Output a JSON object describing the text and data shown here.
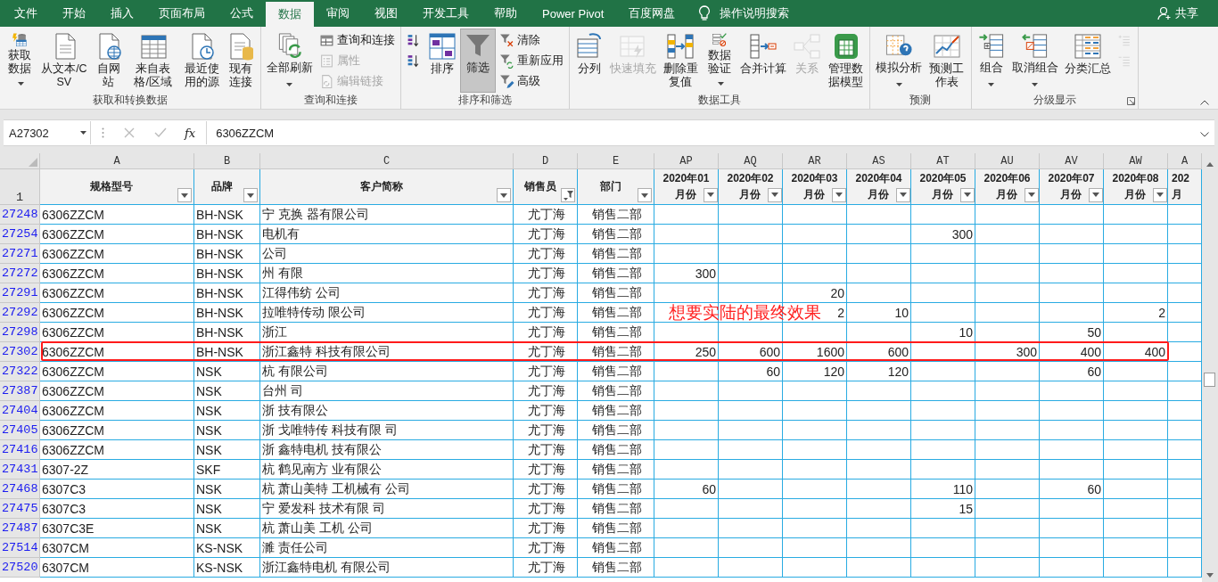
{
  "title_bar": {
    "tabs": [
      {
        "label": "文件",
        "selected": false
      },
      {
        "label": "开始",
        "selected": false
      },
      {
        "label": "插入",
        "selected": false
      },
      {
        "label": "页面布局",
        "selected": false
      },
      {
        "label": "公式",
        "selected": false
      },
      {
        "label": "数据",
        "selected": true
      },
      {
        "label": "审阅",
        "selected": false
      },
      {
        "label": "视图",
        "selected": false
      },
      {
        "label": "开发工具",
        "selected": false
      },
      {
        "label": "帮助",
        "selected": false
      },
      {
        "label": "Power Pivot",
        "selected": false
      },
      {
        "label": "百度网盘",
        "selected": false
      }
    ],
    "search": "操作说明搜索",
    "share": "共享"
  },
  "ribbon": {
    "groups": [
      {
        "label": "获取和转换数据",
        "launcher": false,
        "buttons": [
          {
            "kind": "tall",
            "label": "获取数据",
            "dropdown": true,
            "disabled": false,
            "pressed": false
          },
          {
            "kind": "tall",
            "label": "从文本/CSV",
            "dropdown": false,
            "disabled": false,
            "pressed": false
          },
          {
            "kind": "tall",
            "label": "自网站",
            "dropdown": false,
            "disabled": false,
            "pressed": false
          },
          {
            "kind": "tall",
            "label": "来自表格/区域",
            "dropdown": false,
            "disabled": false,
            "pressed": false
          },
          {
            "kind": "tall",
            "label": "最近使用的源",
            "dropdown": false,
            "disabled": false,
            "pressed": false
          },
          {
            "kind": "tall",
            "label": "现有连接",
            "dropdown": false,
            "disabled": false,
            "pressed": false
          }
        ]
      },
      {
        "label": "查询和连接",
        "launcher": false,
        "buttons": [
          {
            "kind": "large",
            "label": "全部刷新",
            "dropdown": true,
            "disabled": false,
            "pressed": false
          },
          {
            "kind": "small",
            "label": "查询和连接",
            "dropdown": false,
            "disabled": false,
            "pressed": false
          },
          {
            "kind": "small",
            "label": "属性",
            "dropdown": false,
            "disabled": true,
            "pressed": false
          },
          {
            "kind": "small",
            "label": "编辑链接",
            "dropdown": false,
            "disabled": true,
            "pressed": false
          }
        ]
      },
      {
        "label": "排序和筛选",
        "launcher": false,
        "buttons": [
          {
            "kind": "icon",
            "dropdown": false,
            "disabled": false,
            "pressed": false
          },
          {
            "kind": "icon",
            "dropdown": false,
            "disabled": false,
            "pressed": false
          },
          {
            "kind": "large",
            "label": "排序",
            "dropdown": false,
            "disabled": false,
            "pressed": false
          },
          {
            "kind": "large",
            "label": "筛选",
            "dropdown": false,
            "disabled": false,
            "pressed": true
          },
          {
            "kind": "small",
            "label": "清除",
            "dropdown": false,
            "disabled": false,
            "pressed": false
          },
          {
            "kind": "small",
            "label": "重新应用",
            "dropdown": false,
            "disabled": false,
            "pressed": false
          },
          {
            "kind": "small",
            "label": "高级",
            "dropdown": false,
            "disabled": false,
            "pressed": false
          }
        ]
      },
      {
        "label": "数据工具",
        "launcher": false,
        "buttons": [
          {
            "kind": "large",
            "label": "分列",
            "dropdown": false,
            "disabled": false,
            "pressed": false
          },
          {
            "kind": "large",
            "label": "快速填充",
            "dropdown": false,
            "disabled": true,
            "pressed": false
          },
          {
            "kind": "tall",
            "label": "删除重复值",
            "dropdown": false,
            "disabled": false,
            "pressed": false
          },
          {
            "kind": "tall",
            "label": "数据验证",
            "dropdown": true,
            "disabled": false,
            "pressed": false
          },
          {
            "kind": "large",
            "label": "合并计算",
            "dropdown": false,
            "disabled": false,
            "pressed": false
          },
          {
            "kind": "large",
            "label": "关系",
            "dropdown": false,
            "disabled": true,
            "pressed": false
          },
          {
            "kind": "tall",
            "label": "管理数据模型",
            "dropdown": false,
            "disabled": false,
            "pressed": false
          }
        ]
      },
      {
        "label": "预测",
        "launcher": false,
        "buttons": [
          {
            "kind": "large",
            "label": "模拟分析",
            "dropdown": true,
            "disabled": false,
            "pressed": false
          },
          {
            "kind": "tall",
            "label": "预测工作表",
            "dropdown": false,
            "disabled": false,
            "pressed": false
          }
        ]
      },
      {
        "label": "分级显示",
        "launcher": true,
        "buttons": [
          {
            "kind": "large",
            "label": "组合",
            "dropdown": true,
            "disabled": false,
            "pressed": false
          },
          {
            "kind": "large",
            "label": "取消组合",
            "dropdown": true,
            "disabled": false,
            "pressed": false
          },
          {
            "kind": "large",
            "label": "分类汇总",
            "dropdown": false,
            "disabled": false,
            "pressed": false
          },
          {
            "kind": "icon",
            "dropdown": false,
            "disabled": true,
            "pressed": false
          },
          {
            "kind": "icon",
            "dropdown": false,
            "disabled": true,
            "pressed": false
          }
        ]
      }
    ]
  },
  "formula_bar": {
    "name_box": "A27302",
    "function_label": "fx",
    "value": "6306ZZCM"
  },
  "sheet": {
    "columns": [
      {
        "letter": "A",
        "label": "规格型号",
        "filtered": false
      },
      {
        "letter": "B",
        "label": "品牌",
        "filtered": false
      },
      {
        "letter": "C",
        "label": "客户简称",
        "filtered": false
      },
      {
        "letter": "D",
        "label": "销售员",
        "filtered": true
      },
      {
        "letter": "E",
        "label": "部门",
        "filtered": false
      },
      {
        "letter": "AP",
        "label": "2020年01",
        "sublabel": "月份",
        "filtered": false
      },
      {
        "letter": "AQ",
        "label": "2020年02",
        "sublabel": "月份",
        "filtered": false
      },
      {
        "letter": "AR",
        "label": "2020年03",
        "sublabel": "月份",
        "filtered": false
      },
      {
        "letter": "AS",
        "label": "2020年04",
        "sublabel": "月份",
        "filtered": false
      },
      {
        "letter": "AT",
        "label": "2020年05",
        "sublabel": "月份",
        "filtered": false
      },
      {
        "letter": "AU",
        "label": "2020年06",
        "sublabel": "月份",
        "filtered": false
      },
      {
        "letter": "AV",
        "label": "2020年07",
        "sublabel": "月份",
        "filtered": false
      },
      {
        "letter": "AW",
        "label": "2020年08",
        "sublabel": "月份",
        "filtered": false
      }
    ],
    "partial_column": {
      "letter": "A",
      "label": "202",
      "sublabel": "月"
    },
    "header_row_number": "1",
    "rows": [
      {
        "row_number": "27248",
        "cells": [
          "6306ZZCM",
          "BH-NSK",
          "宁 克换 器有限公司",
          "尤丁海",
          "销售二部",
          null,
          null,
          null,
          null,
          null,
          null,
          null,
          null
        ],
        "outlined": false
      },
      {
        "row_number": "27254",
        "cells": [
          "6306ZZCM",
          "BH-NSK",
          "电机有",
          "尤丁海",
          "销售二部",
          null,
          null,
          null,
          null,
          "300",
          null,
          null,
          null
        ],
        "outlined": false
      },
      {
        "row_number": "27271",
        "cells": [
          "6306ZZCM",
          "BH-NSK",
          "公司",
          "尤丁海",
          "销售二部",
          null,
          null,
          null,
          null,
          null,
          null,
          null,
          null
        ],
        "outlined": false
      },
      {
        "row_number": "27272",
        "cells": [
          "6306ZZCM",
          "BH-NSK",
          "州 有限",
          "尤丁海",
          "销售二部",
          "300",
          null,
          null,
          null,
          null,
          null,
          null,
          null
        ],
        "outlined": false
      },
      {
        "row_number": "27291",
        "cells": [
          "6306ZZCM",
          "BH-NSK",
          "江得伟纺 公司",
          "尤丁海",
          "销售二部",
          null,
          null,
          "20",
          null,
          null,
          null,
          null,
          null
        ],
        "outlined": false
      },
      {
        "row_number": "27292",
        "cells": [
          "6306ZZCM",
          "BH-NSK",
          "拉唯特传动 限公司",
          "尤丁海",
          "销售二部",
          null,
          null,
          "2",
          "10",
          null,
          null,
          null,
          "2"
        ],
        "outlined": false
      },
      {
        "row_number": "27298",
        "cells": [
          "6306ZZCM",
          "BH-NSK",
          "浙江",
          "尤丁海",
          "销售二部",
          null,
          null,
          null,
          null,
          "10",
          null,
          "50",
          null
        ],
        "outlined": false
      },
      {
        "row_number": "27302",
        "cells": [
          "6306ZZCM",
          "BH-NSK",
          "浙江鑫特 科技有限公司",
          "尤丁海",
          "销售二部",
          "250",
          "600",
          "1600",
          "600",
          null,
          "300",
          "400",
          "400"
        ],
        "outlined": true
      },
      {
        "row_number": "27322",
        "cells": [
          "6306ZZCM",
          "NSK",
          "杭 有限公司",
          "尤丁海",
          "销售二部",
          null,
          "60",
          "120",
          "120",
          null,
          null,
          "60",
          null
        ],
        "outlined": false
      },
      {
        "row_number": "27387",
        "cells": [
          "6306ZZCM",
          "NSK",
          "台州 司",
          "尤丁海",
          "销售二部",
          null,
          null,
          null,
          null,
          null,
          null,
          null,
          null
        ],
        "outlined": false
      },
      {
        "row_number": "27404",
        "cells": [
          "6306ZZCM",
          "NSK",
          "浙 技有限公",
          "尤丁海",
          "销售二部",
          null,
          null,
          null,
          null,
          null,
          null,
          null,
          null
        ],
        "outlined": false
      },
      {
        "row_number": "27405",
        "cells": [
          "6306ZZCM",
          "NSK",
          "浙 戈唯特传 科技有限 司",
          "尤丁海",
          "销售二部",
          null,
          null,
          null,
          null,
          null,
          null,
          null,
          null
        ],
        "outlined": false
      },
      {
        "row_number": "27416",
        "cells": [
          "6306ZZCM",
          "NSK",
          "浙 鑫特电机 技有限公",
          "尤丁海",
          "销售二部",
          null,
          null,
          null,
          null,
          null,
          null,
          null,
          null
        ],
        "outlined": false
      },
      {
        "row_number": "27431",
        "cells": [
          "6307-2Z",
          "SKF",
          "杭 鹤见南方 业有限公",
          "尤丁海",
          "销售二部",
          null,
          null,
          null,
          null,
          null,
          null,
          null,
          null
        ],
        "outlined": false
      },
      {
        "row_number": "27468",
        "cells": [
          "6307C3",
          "NSK",
          "杭 萧山美特 工机械有 公司",
          "尤丁海",
          "销售二部",
          "60",
          null,
          null,
          null,
          "110",
          null,
          "60",
          null
        ],
        "outlined": false
      },
      {
        "row_number": "27475",
        "cells": [
          "6307C3",
          "NSK",
          "宁 爱发科 技术有限 司",
          "尤丁海",
          "销售二部",
          null,
          null,
          null,
          null,
          "15",
          null,
          null,
          null
        ],
        "outlined": false
      },
      {
        "row_number": "27487",
        "cells": [
          "6307C3E",
          "NSK",
          "杭 萧山美 工机 公司",
          "尤丁海",
          "销售二部",
          null,
          null,
          null,
          null,
          null,
          null,
          null,
          null
        ],
        "outlined": false
      },
      {
        "row_number": "27514",
        "cells": [
          "6307CM",
          "KS-NSK",
          "濉 责任公司",
          "尤丁海",
          "销售二部",
          null,
          null,
          null,
          null,
          null,
          null,
          null,
          null
        ],
        "outlined": false
      },
      {
        "row_number": "27520",
        "cells": [
          "6307CM",
          "KS-NSK",
          "浙江鑫特电机 有限公司",
          "尤丁海",
          "销售二部",
          null,
          null,
          null,
          null,
          null,
          null,
          null,
          null
        ],
        "outlined": false
      }
    ],
    "annotation": "想要实陆的最终效果"
  }
}
